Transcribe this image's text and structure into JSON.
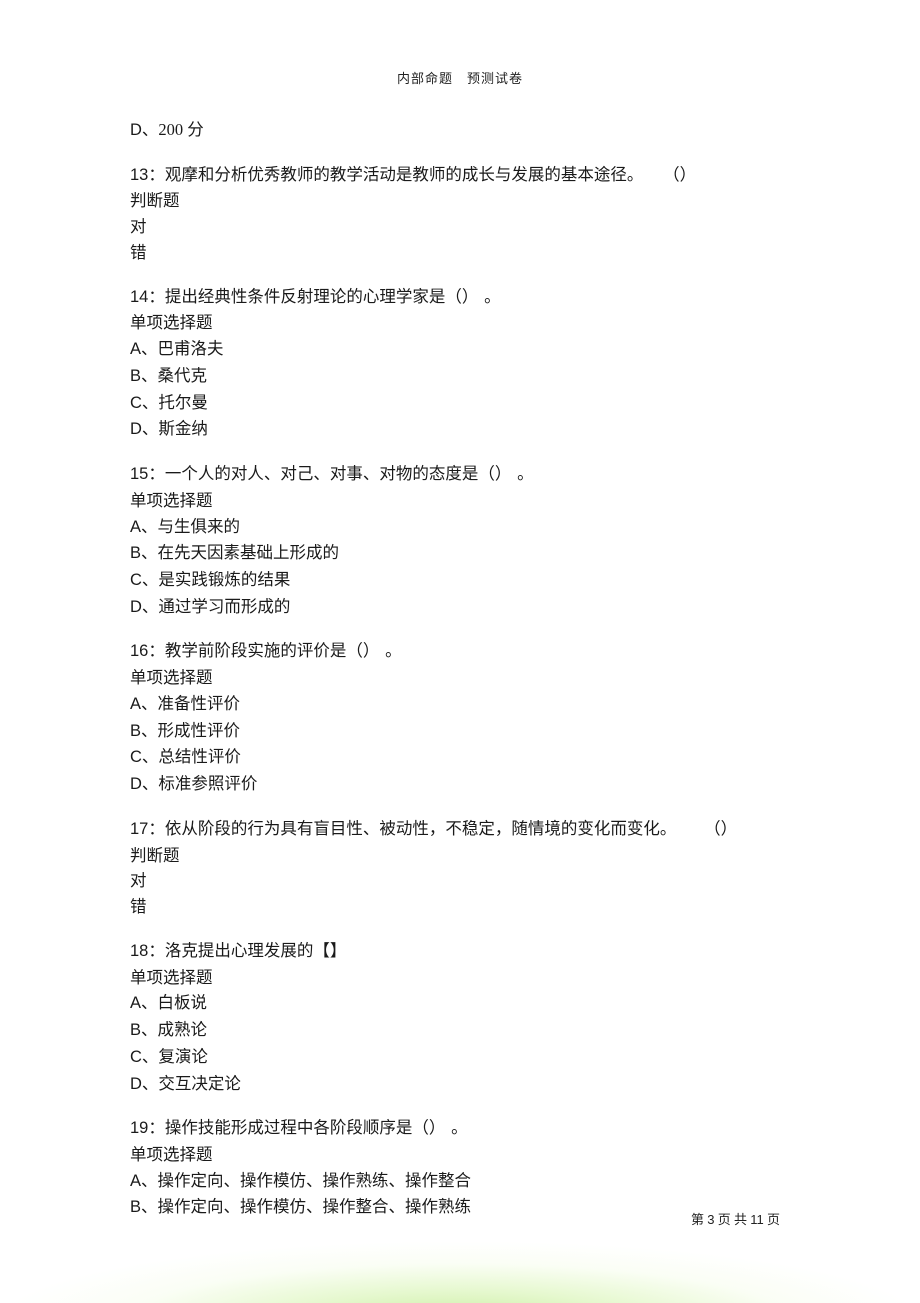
{
  "header": {
    "left": "内部命题",
    "right": "预测试卷"
  },
  "remnant": {
    "label": "D、",
    "text": "200 分"
  },
  "questions": [
    {
      "id": "q13",
      "num": "13：",
      "stem": "观摩和分析优秀教师的教学活动是教师的成长与发展的基本途径。",
      "paren": "（）",
      "after_paren": "",
      "type": "判断题",
      "options": [
        {
          "label": "",
          "text": "对"
        },
        {
          "label": "",
          "text": "错"
        }
      ]
    },
    {
      "id": "q14",
      "num": "14：",
      "stem": "提出经典性条件反射理论的心理学家是（）",
      "paren": "",
      "after_paren": "。",
      "type": "单项选择题",
      "options": [
        {
          "label": "A、",
          "text": "巴甫洛夫"
        },
        {
          "label": "B、",
          "text": "桑代克"
        },
        {
          "label": "C、",
          "text": "托尔曼"
        },
        {
          "label": "D、",
          "text": "斯金纳"
        }
      ]
    },
    {
      "id": "q15",
      "num": "15：",
      "stem": "一个人的对人、对己、对事、对物的态度是（）",
      "paren": "",
      "after_paren": "。",
      "type": "单项选择题",
      "options": [
        {
          "label": "A、",
          "text": "与生俱来的"
        },
        {
          "label": "B、",
          "text": "在先天因素基础上形成的"
        },
        {
          "label": "C、",
          "text": "是实践锻炼的结果"
        },
        {
          "label": "D、",
          "text": "通过学习而形成的"
        }
      ]
    },
    {
      "id": "q16",
      "num": "16：",
      "stem": "教学前阶段实施的评价是（）",
      "paren": "",
      "after_paren": "。",
      "type": "单项选择题",
      "options": [
        {
          "label": "A、",
          "text": "准备性评价"
        },
        {
          "label": "B、",
          "text": "形成性评价"
        },
        {
          "label": "C、",
          "text": "总结性评价"
        },
        {
          "label": "D、",
          "text": "标准参照评价"
        }
      ]
    },
    {
      "id": "q17",
      "num": "17：",
      "stem": "依从阶段的行为具有盲目性、被动性，不稳定，随情境的变化而变化。",
      "paren": "（）",
      "after_paren": "",
      "type": "判断题",
      "options": [
        {
          "label": "",
          "text": "对"
        },
        {
          "label": "",
          "text": "错"
        }
      ]
    },
    {
      "id": "q18",
      "num": "18：",
      "stem": "洛克提出心理发展的【】",
      "paren": "",
      "after_paren": "",
      "type": "单项选择题",
      "options": [
        {
          "label": "A、",
          "text": "白板说"
        },
        {
          "label": "B、",
          "text": "成熟论"
        },
        {
          "label": "C、",
          "text": "复演论"
        },
        {
          "label": "D、",
          "text": "交互决定论"
        }
      ]
    },
    {
      "id": "q19",
      "num": "19：",
      "stem": "操作技能形成过程中各阶段顺序是（）",
      "paren": "",
      "after_paren": "。",
      "type": "单项选择题",
      "options": [
        {
          "label": "A、",
          "text": "操作定向、操作模仿、操作熟练、操作整合"
        },
        {
          "label": "B、",
          "text": "操作定向、操作模仿、操作整合、操作熟练"
        }
      ]
    }
  ],
  "footer": {
    "p1": "第 ",
    "pn": "3",
    "p2": " 页 共 ",
    "pt": "11",
    "p3": " 页"
  }
}
